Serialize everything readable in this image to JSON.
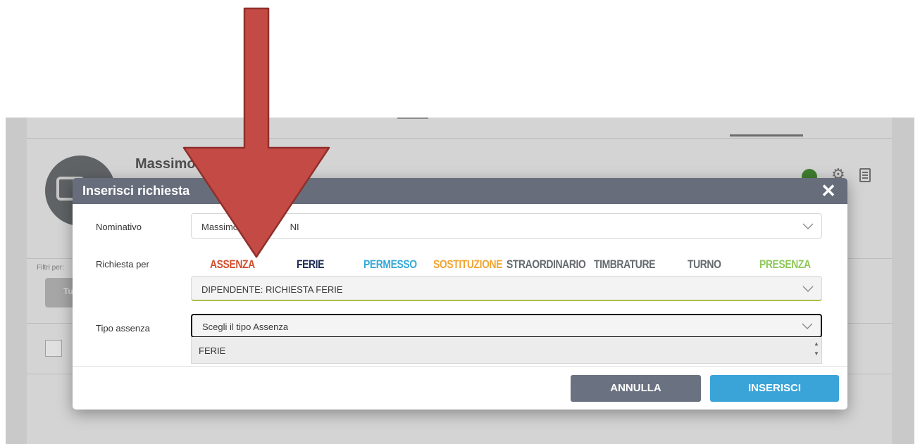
{
  "background_app": {
    "user_name": "Massimo",
    "filters_label": "Filtri per:",
    "filters_button": "Tu"
  },
  "modal": {
    "title": "Inserisci richiesta",
    "close_icon": "close-icon",
    "labels": {
      "nominativo": "Nominativo",
      "richiesta_per": "Richiesta per",
      "tipo_assenza": "Tipo assenza"
    },
    "nominativo_value": "Massimo",
    "nominativo_value_suffix": "NI",
    "categories": [
      {
        "label": "ASSENZA",
        "color": "#d2502f"
      },
      {
        "label": "FERIE",
        "color": "#1b2a55"
      },
      {
        "label": "PERMESSO",
        "color": "#36a9d6"
      },
      {
        "label": "SOSTITUZIONE",
        "color": "#f0a534"
      },
      {
        "label": "STRAORDINARIO",
        "color": "#666a70"
      },
      {
        "label": "TIMBRATURE",
        "color": "#666a70"
      },
      {
        "label": "TURNO",
        "color": "#666a70"
      },
      {
        "label": "PRESENZA",
        "color": "#8ec85a"
      }
    ],
    "richiesta_value": "DIPENDENTE: RICHIESTA FERIE",
    "tipo_assenza_placeholder": "Scegli il tipo Assenza",
    "tipo_assenza_options": [
      "FERIE"
    ],
    "buttons": {
      "annulla": "ANNULLA",
      "inserisci": "INSERISCI"
    }
  },
  "overlay": {
    "arrow_color": "#c44b45",
    "arrow_direction": "down"
  }
}
